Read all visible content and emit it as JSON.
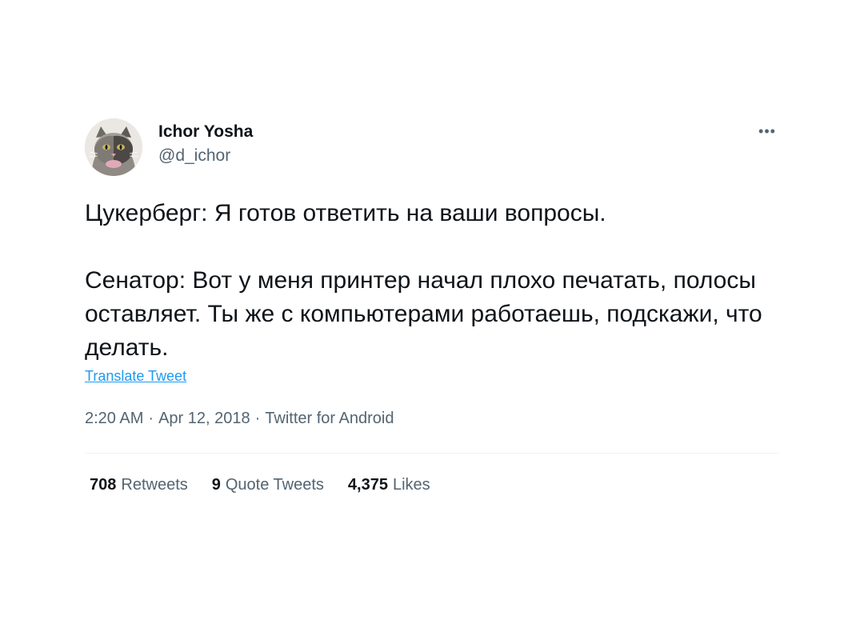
{
  "author": {
    "display_name": "Ichor Yosha",
    "handle": "@d_ichor",
    "avatar_icon": "cat-avatar-icon"
  },
  "more_icon": "more-horizontal-icon",
  "tweet": {
    "text": "Цукерберг: Я готов ответить на ваши вопросы.\n\nСенатор: Вот у меня принтер начал плохо печатать, полосы оставляет. Ты же с компьютерами работаешь, подскажи, что делать.",
    "translate_label": "Translate Tweet"
  },
  "meta": {
    "time": "2:20 AM",
    "date": "Apr 12, 2018",
    "source": "Twitter for Android",
    "separator": "·"
  },
  "stats": {
    "retweets_count": "708",
    "retweets_label": "Retweets",
    "quotes_count": "9",
    "quotes_label": "Quote Tweets",
    "likes_count": "4,375",
    "likes_label": "Likes"
  },
  "colors": {
    "link": "#1d9bf0",
    "secondary_text": "#536471",
    "primary_text": "#0f1419",
    "divider": "#eff3f4"
  }
}
